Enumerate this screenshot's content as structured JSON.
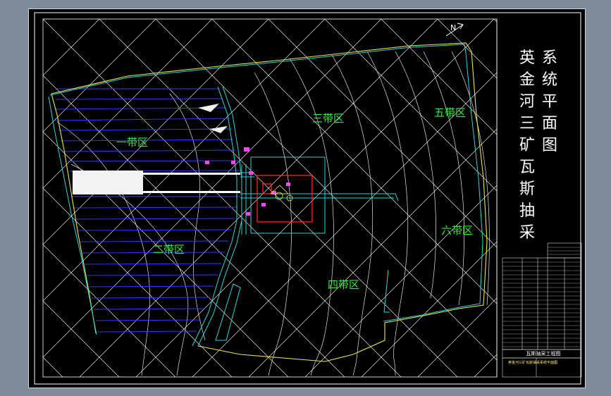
{
  "drawing": {
    "title_lines": [
      "英金河三矿瓦斯抽采",
      "系统平面图"
    ],
    "zones": [
      {
        "id": "zone-1",
        "label": "一带区"
      },
      {
        "id": "zone-2",
        "label": "二带区"
      },
      {
        "id": "zone-3",
        "label": "三带区"
      },
      {
        "id": "zone-4",
        "label": "四带区"
      },
      {
        "id": "zone-5",
        "label": "五带区"
      },
      {
        "id": "zone-6",
        "label": "六带区"
      }
    ],
    "north_marker": "N",
    "title_block": {
      "title": "瓦斯抽采工程图",
      "subtitle": "英金河三矿瓦斯抽采系统平面图"
    }
  },
  "colors": {
    "background": "#000000",
    "frame_outer": "#7f8b9b",
    "grid_lines": "#e6e6e6",
    "yellow_boundary": "#e8e84a",
    "cyan_roads": "#2fd6d6",
    "blue_lines": "#2f3fff",
    "green_text": "#39e639",
    "magenta_labels": "#ff44ff",
    "red_box": "#ff2222"
  }
}
